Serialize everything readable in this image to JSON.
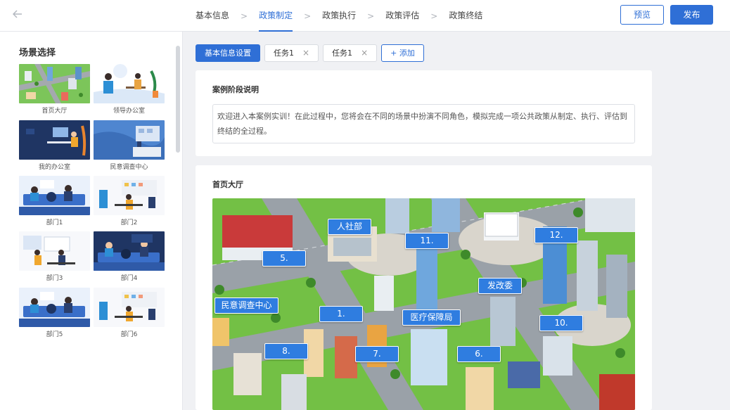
{
  "header": {
    "back_icon": "arrow-left-icon",
    "steps": [
      {
        "label": "基本信息"
      },
      {
        "label": "政策制定"
      },
      {
        "label": "政策执行"
      },
      {
        "label": "政策评估"
      },
      {
        "label": "政策终结"
      }
    ],
    "active_step": 1,
    "separator": ">",
    "preview_label": "预览",
    "publish_label": "发布"
  },
  "sidebar": {
    "title": "场景选择",
    "scenes": [
      {
        "label": "首页大厅"
      },
      {
        "label": "领导办公室"
      },
      {
        "label": "我的办公室"
      },
      {
        "label": "民意调查中心"
      },
      {
        "label": "部门1"
      },
      {
        "label": "部门2"
      },
      {
        "label": "部门3"
      },
      {
        "label": "部门4"
      },
      {
        "label": "部门5"
      },
      {
        "label": "部门6"
      }
    ]
  },
  "tabs": {
    "items": [
      {
        "label": "基本信息设置"
      },
      {
        "label": "任务1",
        "close": "×"
      },
      {
        "label": "任务1",
        "close": "×"
      }
    ],
    "add_label": "+  添加"
  },
  "stage": {
    "title": "案例阶段说明",
    "description": "欢迎进入本案例实训！在此过程中，您将会在不同的场景中扮演不同角色，模拟完成一项公共政策从制定、执行、评估到终结的全过程。"
  },
  "scene_view": {
    "title": "首页大厅",
    "labels": [
      {
        "text": "人社部"
      },
      {
        "text": "11."
      },
      {
        "text": "12."
      },
      {
        "text": "5."
      },
      {
        "text": "发改委"
      },
      {
        "text": "民意调查中心"
      },
      {
        "text": "1."
      },
      {
        "text": "医疗保障局"
      },
      {
        "text": "10."
      },
      {
        "text": "8."
      },
      {
        "text": "7."
      },
      {
        "text": "6."
      }
    ]
  },
  "colors": {
    "primary": "#2f6fd6",
    "label_blue": "#2f7de0",
    "grass": "#6fbf3f",
    "road": "#9aa1a8"
  }
}
